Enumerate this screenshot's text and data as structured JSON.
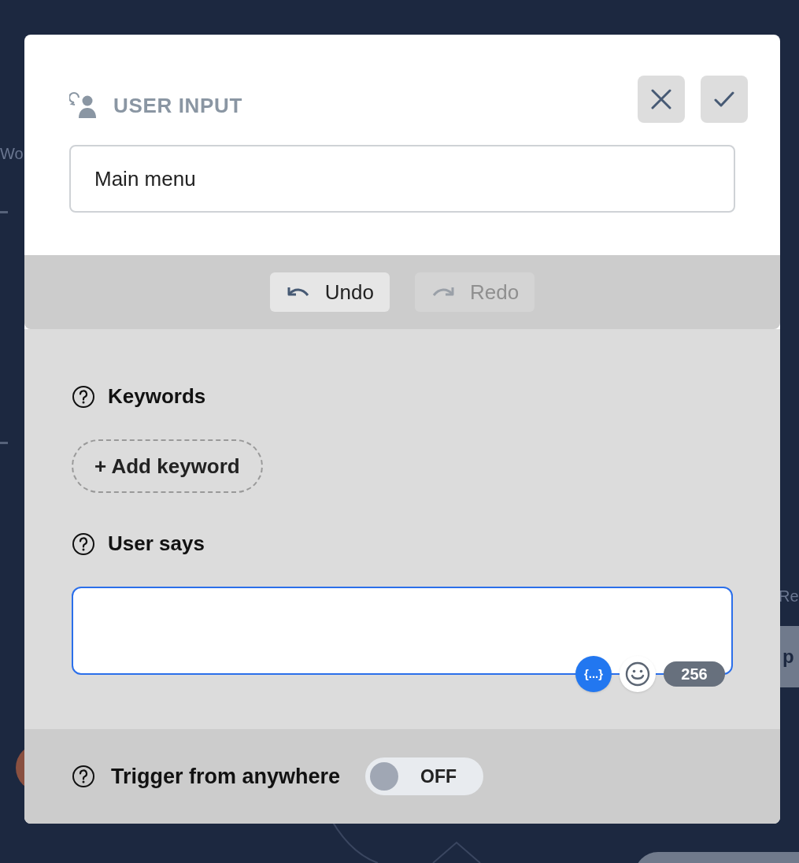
{
  "background": {
    "labels": [
      {
        "text": "Wo"
      },
      {
        "text": "Re"
      }
    ],
    "node_text": "p"
  },
  "dialog": {
    "title": "USER INPUT",
    "name_value": "Main menu",
    "toolbar": [
      {
        "kind": "undo",
        "label": "Undo",
        "disabled": false
      },
      {
        "kind": "redo",
        "label": "Redo",
        "disabled": true
      }
    ],
    "keywords": {
      "label": "Keywords",
      "add_button": "+ Add keyword"
    },
    "user_says": {
      "label": "User says",
      "variable_button": "{...}",
      "char_count": "256"
    },
    "trigger": {
      "label": "Trigger from anywhere",
      "on": false,
      "state_text": "OFF"
    }
  }
}
